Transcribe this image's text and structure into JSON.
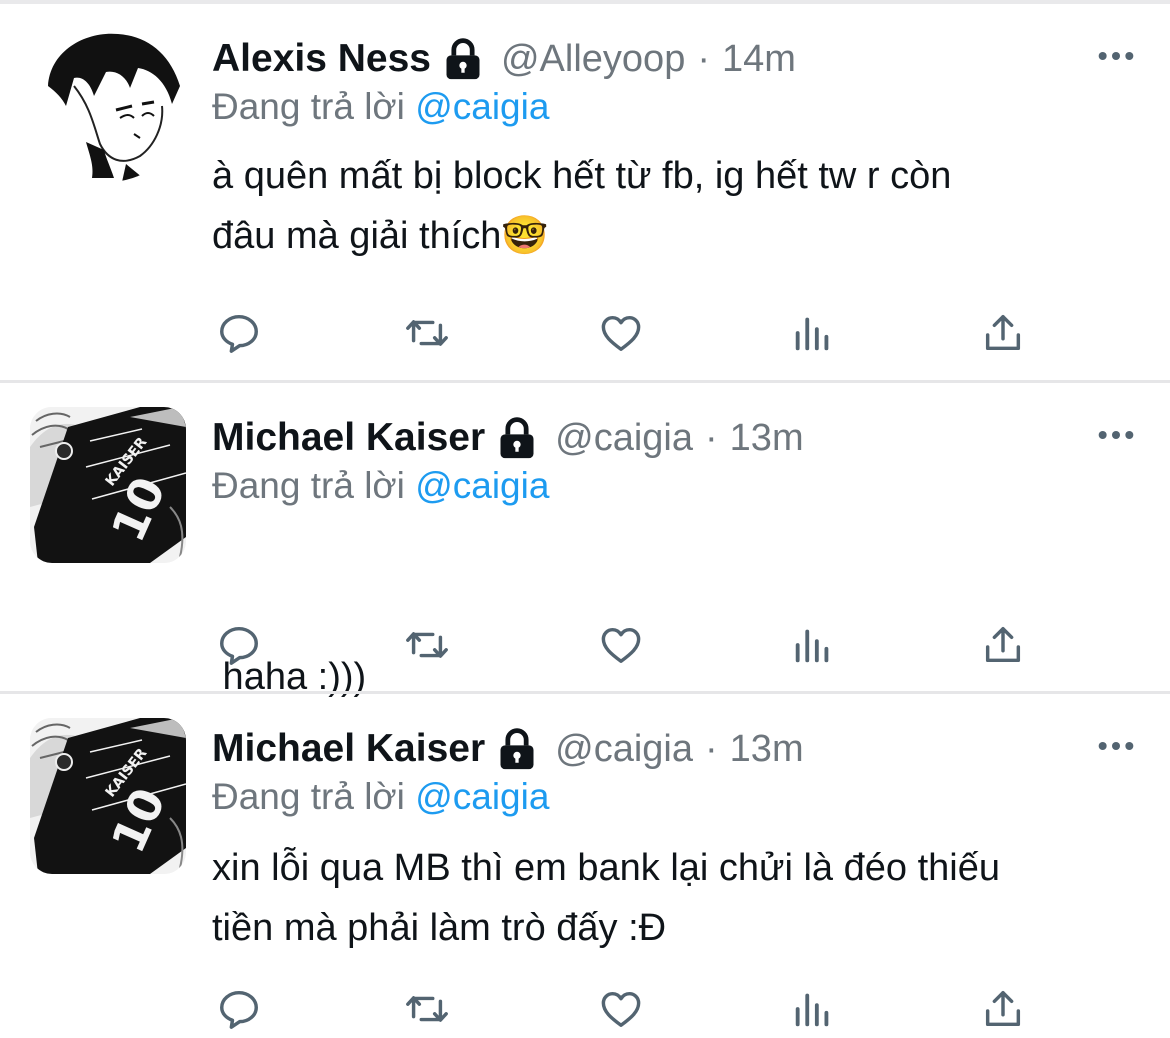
{
  "tweets": [
    {
      "name": "Alexis Ness",
      "handle": "@Alleyoop",
      "separator": "·",
      "time": "14m",
      "reply_prefix": "Đang trả lời",
      "reply_to": "@caigia",
      "text_lines": [
        "à quên mất bị block hết từ fb, ig hết tw r còn",
        "đâu mà giải thích🤓"
      ],
      "avatar_icon": "manga-avatar-icon"
    },
    {
      "name": "Michael Kaiser",
      "handle": "@caigia",
      "separator": "·",
      "time": "13m",
      "reply_prefix": "Đang trả lời",
      "reply_to": "@caigia",
      "text_lines": [
        " haha :)))"
      ],
      "avatar_icon": "kaiser-avatar-icon",
      "jersey_name": "KAISER",
      "jersey_number": "10"
    },
    {
      "name": "Michael Kaiser",
      "handle": "@caigia",
      "separator": "·",
      "time": "13m",
      "reply_prefix": "Đang trả lời",
      "reply_to": "@caigia",
      "text_lines": [
        "xin lỗi qua MB thì em bank lại chửi là đéo thiếu",
        "tiền mà phải làm trò đấy :Đ"
      ],
      "avatar_icon": "kaiser-avatar-icon",
      "jersey_name": "KAISER",
      "jersey_number": "10"
    }
  ],
  "icons": {
    "lock": "lock-icon",
    "more": "more-options-icon",
    "reply": "reply-icon",
    "retweet": "retweet-icon",
    "like": "like-icon",
    "views": "views-icon",
    "share": "share-icon"
  },
  "colors": {
    "text": "#0f1419",
    "secondary": "#6e767d",
    "mention": "#1d9bf0",
    "divider": "#e6e6e8"
  }
}
